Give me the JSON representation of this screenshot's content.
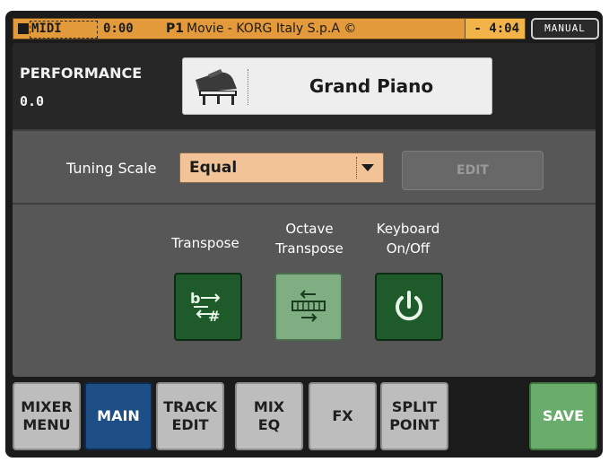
{
  "header": {
    "midi_label": "MIDI",
    "time_elapsed": "0:00",
    "slot": "P1",
    "song_title": "Movie - KORG Italy S.p.A ©",
    "time_remaining": "- 4:04",
    "mode_badge": "MANUAL"
  },
  "performance": {
    "label": "PERFORMANCE",
    "number": "0.0",
    "sound_name": "Grand Piano"
  },
  "tuning": {
    "label": "Tuning Scale",
    "value": "Equal",
    "edit_label": "EDIT"
  },
  "functions": [
    {
      "label": "Transpose",
      "icon": "transpose-icon"
    },
    {
      "label": "Octave\nTranspose",
      "icon": "octave-transpose-icon"
    },
    {
      "label": "Keyboard\nOn/Off",
      "icon": "power-icon"
    }
  ],
  "tabs": [
    {
      "label": "MIXER\nMENU",
      "active": false
    },
    {
      "label": "MAIN",
      "active": true
    },
    {
      "label": "TRACK\nEDIT",
      "active": false
    },
    {
      "label": "MIX\nEQ",
      "active": false
    },
    {
      "label": "FX",
      "active": false
    },
    {
      "label": "SPLIT\nPOINT",
      "active": false
    },
    {
      "label": "SAVE",
      "active": false
    }
  ],
  "colors": {
    "header": "#e39a3a",
    "active_tab": "#1d4e86",
    "save_tab": "#6aac6c",
    "function_on": "#1f5a2b",
    "function_light": "#7eae82"
  }
}
